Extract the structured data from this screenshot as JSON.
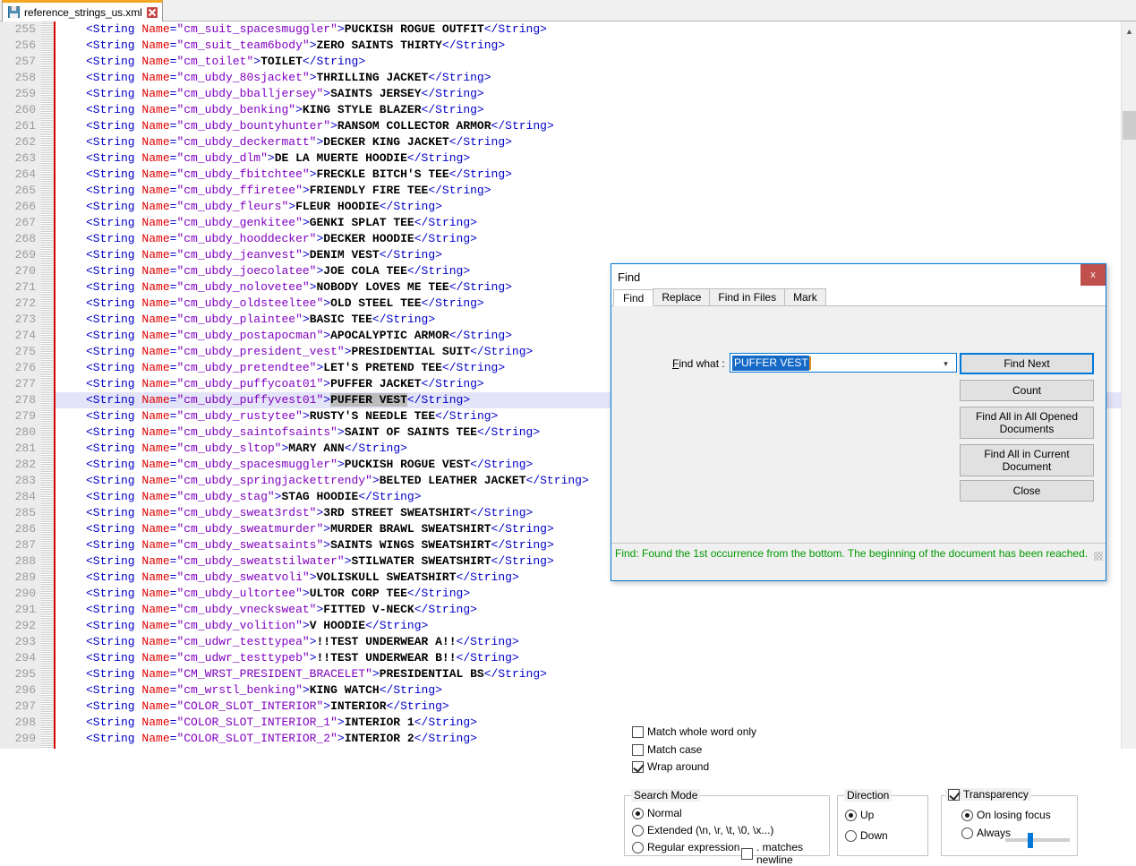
{
  "tab": {
    "filename": "reference_strings_us.xml",
    "save_icon": "save-floppy-icon",
    "close_icon": "close-tab-icon"
  },
  "editor": {
    "first_line": 255,
    "highlighted_line": 278,
    "lines": [
      {
        "n": 255,
        "tag_open": "<String ",
        "attr": "Name",
        "eq": "=",
        "val": "\"cm_suit_spacesmuggler\"",
        "gt": ">",
        "text": "PUCKISH ROGUE OUTFIT",
        "tag_close": "</String>"
      },
      {
        "n": 256,
        "tag_open": "<String ",
        "attr": "Name",
        "eq": "=",
        "val": "\"cm_suit_team6body\"",
        "gt": ">",
        "text": "ZERO SAINTS THIRTY",
        "tag_close": "</String>"
      },
      {
        "n": 257,
        "tag_open": "<String ",
        "attr": "Name",
        "eq": "=",
        "val": "\"cm_toilet\"",
        "gt": ">",
        "text": "TOILET",
        "tag_close": "</String>"
      },
      {
        "n": 258,
        "tag_open": "<String ",
        "attr": "Name",
        "eq": "=",
        "val": "\"cm_ubdy_80sjacket\"",
        "gt": ">",
        "text": "THRILLING JACKET",
        "tag_close": "</String>"
      },
      {
        "n": 259,
        "tag_open": "<String ",
        "attr": "Name",
        "eq": "=",
        "val": "\"cm_ubdy_bballjersey\"",
        "gt": ">",
        "text": "SAINTS JERSEY",
        "tag_close": "</String>"
      },
      {
        "n": 260,
        "tag_open": "<String ",
        "attr": "Name",
        "eq": "=",
        "val": "\"cm_ubdy_benking\"",
        "gt": ">",
        "text": "KING STYLE BLAZER",
        "tag_close": "</String>"
      },
      {
        "n": 261,
        "tag_open": "<String ",
        "attr": "Name",
        "eq": "=",
        "val": "\"cm_ubdy_bountyhunter\"",
        "gt": ">",
        "text": "RANSOM COLLECTOR ARMOR",
        "tag_close": "</String>"
      },
      {
        "n": 262,
        "tag_open": "<String ",
        "attr": "Name",
        "eq": "=",
        "val": "\"cm_ubdy_deckermatt\"",
        "gt": ">",
        "text": "DECKER KING JACKET",
        "tag_close": "</String>"
      },
      {
        "n": 263,
        "tag_open": "<String ",
        "attr": "Name",
        "eq": "=",
        "val": "\"cm_ubdy_dlm\"",
        "gt": ">",
        "text": "DE LA MUERTE HOODIE",
        "tag_close": "</String>"
      },
      {
        "n": 264,
        "tag_open": "<String ",
        "attr": "Name",
        "eq": "=",
        "val": "\"cm_ubdy_fbitchtee\"",
        "gt": ">",
        "text": "FRECKLE BITCH'S TEE",
        "tag_close": "</String>"
      },
      {
        "n": 265,
        "tag_open": "<String ",
        "attr": "Name",
        "eq": "=",
        "val": "\"cm_ubdy_ffiretee\"",
        "gt": ">",
        "text": "FRIENDLY FIRE TEE",
        "tag_close": "</String>"
      },
      {
        "n": 266,
        "tag_open": "<String ",
        "attr": "Name",
        "eq": "=",
        "val": "\"cm_ubdy_fleurs\"",
        "gt": ">",
        "text": "FLEUR HOODIE",
        "tag_close": "</String>"
      },
      {
        "n": 267,
        "tag_open": "<String ",
        "attr": "Name",
        "eq": "=",
        "val": "\"cm_ubdy_genkitee\"",
        "gt": ">",
        "text": "GENKI SPLAT TEE",
        "tag_close": "</String>"
      },
      {
        "n": 268,
        "tag_open": "<String ",
        "attr": "Name",
        "eq": "=",
        "val": "\"cm_ubdy_hooddecker\"",
        "gt": ">",
        "text": "DECKER HOODIE",
        "tag_close": "</String>"
      },
      {
        "n": 269,
        "tag_open": "<String ",
        "attr": "Name",
        "eq": "=",
        "val": "\"cm_ubdy_jeanvest\"",
        "gt": ">",
        "text": "DENIM VEST",
        "tag_close": "</String>"
      },
      {
        "n": 270,
        "tag_open": "<String ",
        "attr": "Name",
        "eq": "=",
        "val": "\"cm_ubdy_joecolatee\"",
        "gt": ">",
        "text": "JOE COLA TEE",
        "tag_close": "</String>"
      },
      {
        "n": 271,
        "tag_open": "<String ",
        "attr": "Name",
        "eq": "=",
        "val": "\"cm_ubdy_nolovetee\"",
        "gt": ">",
        "text": "NOBODY LOVES ME TEE",
        "tag_close": "</String>"
      },
      {
        "n": 272,
        "tag_open": "<String ",
        "attr": "Name",
        "eq": "=",
        "val": "\"cm_ubdy_oldsteeltee\"",
        "gt": ">",
        "text": "OLD STEEL TEE",
        "tag_close": "</String>"
      },
      {
        "n": 273,
        "tag_open": "<String ",
        "attr": "Name",
        "eq": "=",
        "val": "\"cm_ubdy_plaintee\"",
        "gt": ">",
        "text": "BASIC TEE",
        "tag_close": "</String>"
      },
      {
        "n": 274,
        "tag_open": "<String ",
        "attr": "Name",
        "eq": "=",
        "val": "\"cm_ubdy_postapocman\"",
        "gt": ">",
        "text": "APOCALYPTIC ARMOR",
        "tag_close": "</String>"
      },
      {
        "n": 275,
        "tag_open": "<String ",
        "attr": "Name",
        "eq": "=",
        "val": "\"cm_ubdy_president_vest\"",
        "gt": ">",
        "text": "PRESIDENTIAL SUIT",
        "tag_close": "</String>"
      },
      {
        "n": 276,
        "tag_open": "<String ",
        "attr": "Name",
        "eq": "=",
        "val": "\"cm_ubdy_pretendtee\"",
        "gt": ">",
        "text": "LET'S PRETEND TEE",
        "tag_close": "</String>"
      },
      {
        "n": 277,
        "tag_open": "<String ",
        "attr": "Name",
        "eq": "=",
        "val": "\"cm_ubdy_puffycoat01\"",
        "gt": ">",
        "text": "PUFFER JACKET",
        "tag_close": "</String>"
      },
      {
        "n": 278,
        "tag_open": "<String ",
        "attr": "Name",
        "eq": "=",
        "val": "\"cm_ubdy_puffyvest01\"",
        "gt": ">",
        "text": "PUFFER VEST",
        "tag_close": "</String>",
        "selected": true,
        "current": true
      },
      {
        "n": 279,
        "tag_open": "<String ",
        "attr": "Name",
        "eq": "=",
        "val": "\"cm_ubdy_rustytee\"",
        "gt": ">",
        "text": "RUSTY'S NEEDLE TEE",
        "tag_close": "</String>"
      },
      {
        "n": 280,
        "tag_open": "<String ",
        "attr": "Name",
        "eq": "=",
        "val": "\"cm_ubdy_saintofsaints\"",
        "gt": ">",
        "text": "SAINT OF SAINTS TEE",
        "tag_close": "</String>"
      },
      {
        "n": 281,
        "tag_open": "<String ",
        "attr": "Name",
        "eq": "=",
        "val": "\"cm_ubdy_sltop\"",
        "gt": ">",
        "text": "MARY ANN",
        "tag_close": "</String>"
      },
      {
        "n": 282,
        "tag_open": "<String ",
        "attr": "Name",
        "eq": "=",
        "val": "\"cm_ubdy_spacesmuggler\"",
        "gt": ">",
        "text": "PUCKISH ROGUE VEST",
        "tag_close": "</String>"
      },
      {
        "n": 283,
        "tag_open": "<String ",
        "attr": "Name",
        "eq": "=",
        "val": "\"cm_ubdy_springjackettrendy\"",
        "gt": ">",
        "text": "BELTED LEATHER JACKET",
        "tag_close": "</String>"
      },
      {
        "n": 284,
        "tag_open": "<String ",
        "attr": "Name",
        "eq": "=",
        "val": "\"cm_ubdy_stag\"",
        "gt": ">",
        "text": "STAG HOODIE",
        "tag_close": "</String>"
      },
      {
        "n": 285,
        "tag_open": "<String ",
        "attr": "Name",
        "eq": "=",
        "val": "\"cm_ubdy_sweat3rdst\"",
        "gt": ">",
        "text": "3RD STREET SWEATSHIRT",
        "tag_close": "</String>"
      },
      {
        "n": 286,
        "tag_open": "<String ",
        "attr": "Name",
        "eq": "=",
        "val": "\"cm_ubdy_sweatmurder\"",
        "gt": ">",
        "text": "MURDER BRAWL SWEATSHIRT",
        "tag_close": "</String>"
      },
      {
        "n": 287,
        "tag_open": "<String ",
        "attr": "Name",
        "eq": "=",
        "val": "\"cm_ubdy_sweatsaints\"",
        "gt": ">",
        "text": "SAINTS WINGS SWEATSHIRT",
        "tag_close": "</String>"
      },
      {
        "n": 288,
        "tag_open": "<String ",
        "attr": "Name",
        "eq": "=",
        "val": "\"cm_ubdy_sweatstilwater\"",
        "gt": ">",
        "text": "STILWATER SWEATSHIRT",
        "tag_close": "</String>"
      },
      {
        "n": 289,
        "tag_open": "<String ",
        "attr": "Name",
        "eq": "=",
        "val": "\"cm_ubdy_sweatvoli\"",
        "gt": ">",
        "text": "VOLISKULL SWEATSHIRT",
        "tag_close": "</String>"
      },
      {
        "n": 290,
        "tag_open": "<String ",
        "attr": "Name",
        "eq": "=",
        "val": "\"cm_ubdy_ultortee\"",
        "gt": ">",
        "text": "ULTOR CORP TEE",
        "tag_close": "</String>"
      },
      {
        "n": 291,
        "tag_open": "<String ",
        "attr": "Name",
        "eq": "=",
        "val": "\"cm_ubdy_vnecksweat\"",
        "gt": ">",
        "text": "FITTED V-NECK",
        "tag_close": "</String>"
      },
      {
        "n": 292,
        "tag_open": "<String ",
        "attr": "Name",
        "eq": "=",
        "val": "\"cm_ubdy_volition\"",
        "gt": ">",
        "text": "V HOODIE",
        "tag_close": "</String>"
      },
      {
        "n": 293,
        "tag_open": "<String ",
        "attr": "Name",
        "eq": "=",
        "val": "\"cm_udwr_testtypea\"",
        "gt": ">",
        "text": "!!TEST UNDERWEAR A!!",
        "tag_close": "</String>"
      },
      {
        "n": 294,
        "tag_open": "<String ",
        "attr": "Name",
        "eq": "=",
        "val": "\"cm_udwr_testtypeb\"",
        "gt": ">",
        "text": "!!TEST UNDERWEAR B!!",
        "tag_close": "</String>"
      },
      {
        "n": 295,
        "tag_open": "<String ",
        "attr": "Name",
        "eq": "=",
        "val": "\"CM_WRST_PRESIDENT_BRACELET\"",
        "gt": ">",
        "text": "PRESIDENTIAL BS",
        "tag_close": "</String>"
      },
      {
        "n": 296,
        "tag_open": "<String ",
        "attr": "Name",
        "eq": "=",
        "val": "\"cm_wrstl_benking\"",
        "gt": ">",
        "text": "KING WATCH",
        "tag_close": "</String>"
      },
      {
        "n": 297,
        "tag_open": "<String ",
        "attr": "Name",
        "eq": "=",
        "val": "\"COLOR_SLOT_INTERIOR\"",
        "gt": ">",
        "text": "INTERIOR",
        "tag_close": "</String>"
      },
      {
        "n": 298,
        "tag_open": "<String ",
        "attr": "Name",
        "eq": "=",
        "val": "\"COLOR_SLOT_INTERIOR_1\"",
        "gt": ">",
        "text": "INTERIOR 1",
        "tag_close": "</String>"
      },
      {
        "n": 299,
        "tag_open": "<String ",
        "attr": "Name",
        "eq": "=",
        "val": "\"COLOR_SLOT_INTERIOR_2\"",
        "gt": ">",
        "text": "INTERIOR 2",
        "tag_close": "</String>"
      }
    ],
    "scrollbar": {
      "up_arrow": "chevron-up-icon"
    }
  },
  "find_dialog": {
    "title": "Find",
    "close_label": "x",
    "tabs": [
      {
        "label": "Find",
        "active": true
      },
      {
        "label": "Replace",
        "active": false
      },
      {
        "label": "Find in Files",
        "active": false
      },
      {
        "label": "Mark",
        "active": false
      }
    ],
    "find_what": {
      "label": "Find what :",
      "value": "PUFFER VEST",
      "dropdown_icon": "chevron-down-icon"
    },
    "buttons": {
      "find_next": "Find Next",
      "count": "Count",
      "find_all_opened": "Find All in All Opened Documents",
      "find_all_current": "Find All in Current Document",
      "close": "Close"
    },
    "options": [
      {
        "label": "Match whole word only",
        "checked": false
      },
      {
        "label": "Match case",
        "checked": false
      },
      {
        "label": "Wrap around",
        "checked": true
      }
    ],
    "search_mode": {
      "title": "Search Mode",
      "items": [
        {
          "label": "Normal",
          "selected": true
        },
        {
          "label": "Extended (\\n, \\r, \\t, \\0, \\x...)",
          "selected": false
        },
        {
          "label": "Regular expression",
          "selected": false
        }
      ],
      "matches_newline": {
        "label": ". matches newline",
        "checked": false
      }
    },
    "direction": {
      "title": "Direction",
      "items": [
        {
          "label": "Up",
          "selected": true
        },
        {
          "label": "Down",
          "selected": false
        }
      ]
    },
    "transparency": {
      "title": "Transparency",
      "checked": true,
      "items": [
        {
          "label": "On losing focus",
          "selected": true
        },
        {
          "label": "Always",
          "selected": false
        }
      ],
      "slider_percent": 38
    },
    "status": "Find: Found the 1st occurrence from the bottom. The beginning of the document has been reached."
  },
  "colors": {
    "accent": "#0078d7",
    "tag": "#0000c8",
    "attribute": "#e00000",
    "value": "#8000c0",
    "status_text": "#009900",
    "tab_top": "#f5a623",
    "close_button": "#c0504d"
  }
}
